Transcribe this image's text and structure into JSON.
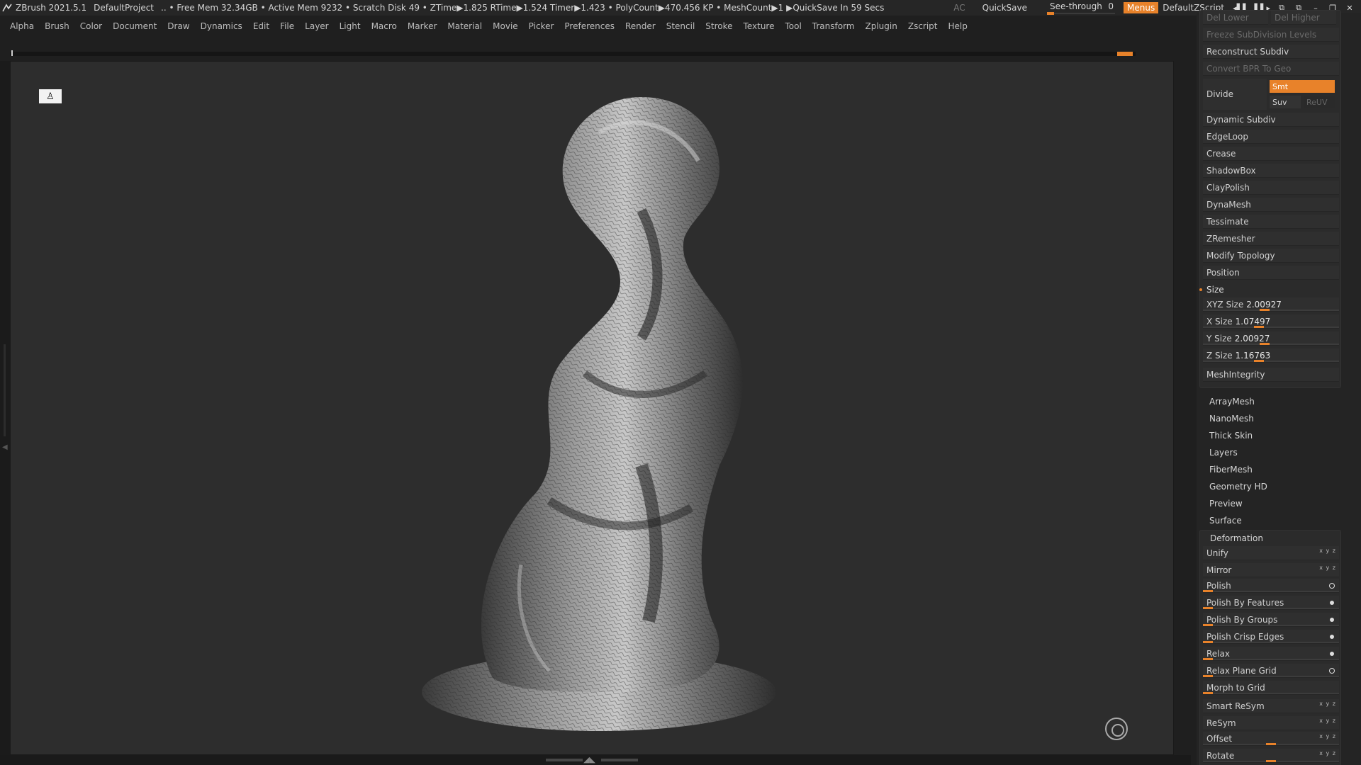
{
  "titlebar": {
    "app": "ZBrush 2021.5.1",
    "project": "DefaultProject",
    "stats": ".. • Free Mem 32.34GB • Active Mem 9232 • Scratch Disk 49 • ZTime▶1.825 RTime▶1.524 Timer▶1.423 • PolyCount▶470.456 KP • MeshCount▶1 ▶QuickSave In 59 Secs",
    "ac": "AC",
    "quicksave": "QuickSave",
    "see_through_label": "See-through",
    "see_through_value": "0",
    "menus": "Menus",
    "default_zscript": "DefaultZScript"
  },
  "menubar": [
    "Alpha",
    "Brush",
    "Color",
    "Document",
    "Draw",
    "Dynamics",
    "Edit",
    "File",
    "Layer",
    "Light",
    "Macro",
    "Marker",
    "Material",
    "Movie",
    "Picker",
    "Preferences",
    "Render",
    "Stencil",
    "Stroke",
    "Texture",
    "Tool",
    "Transform",
    "Zplugin",
    "Zscript",
    "Help"
  ],
  "panel": {
    "del_lower": "Del Lower",
    "del_higher": "Del Higher",
    "freeze": "Freeze SubDivision Levels",
    "reconstruct": "Reconstruct Subdiv",
    "convert_bpr": "Convert BPR To Geo",
    "divide": "Divide",
    "smt": "Smt",
    "suv": "Suv",
    "reuv": "ReUV",
    "geometry_items": [
      "Dynamic Subdiv",
      "EdgeLoop",
      "Crease",
      "ShadowBox",
      "ClayPolish",
      "DynaMesh",
      "Tessimate",
      "ZRemesher",
      "Modify Topology",
      "Position"
    ],
    "size_header": "Size",
    "size": [
      {
        "label": "XYZ Size",
        "value": "2.00927"
      },
      {
        "label": "X Size",
        "value": "1.07497"
      },
      {
        "label": "Y Size",
        "value": "2.00927"
      },
      {
        "label": "Z Size",
        "value": "1.16763"
      }
    ],
    "mesh_integrity": "MeshIntegrity",
    "subpalettes": [
      "ArrayMesh",
      "NanoMesh",
      "Thick Skin",
      "Layers",
      "FiberMesh",
      "Geometry HD",
      "Preview",
      "Surface"
    ],
    "deformation_header": "Deformation",
    "deformation": [
      "Unify",
      "Mirror",
      "Polish",
      "Polish By Features",
      "Polish By Groups",
      "Polish Crisp Edges",
      "Relax",
      "Relax Plane Grid",
      "Morph to Grid",
      "Smart ReSym",
      "ReSym",
      "Offset",
      "Rotate"
    ],
    "xyz_flags": "x y z"
  },
  "colors": {
    "accent": "#e8822a",
    "bg": "#2d2d2d",
    "panel": "#242424"
  },
  "icons": {
    "logo": "zbrush-logo-icon",
    "canvas_corner": "figure-icon",
    "nav": "rotate-navigation-icon"
  }
}
